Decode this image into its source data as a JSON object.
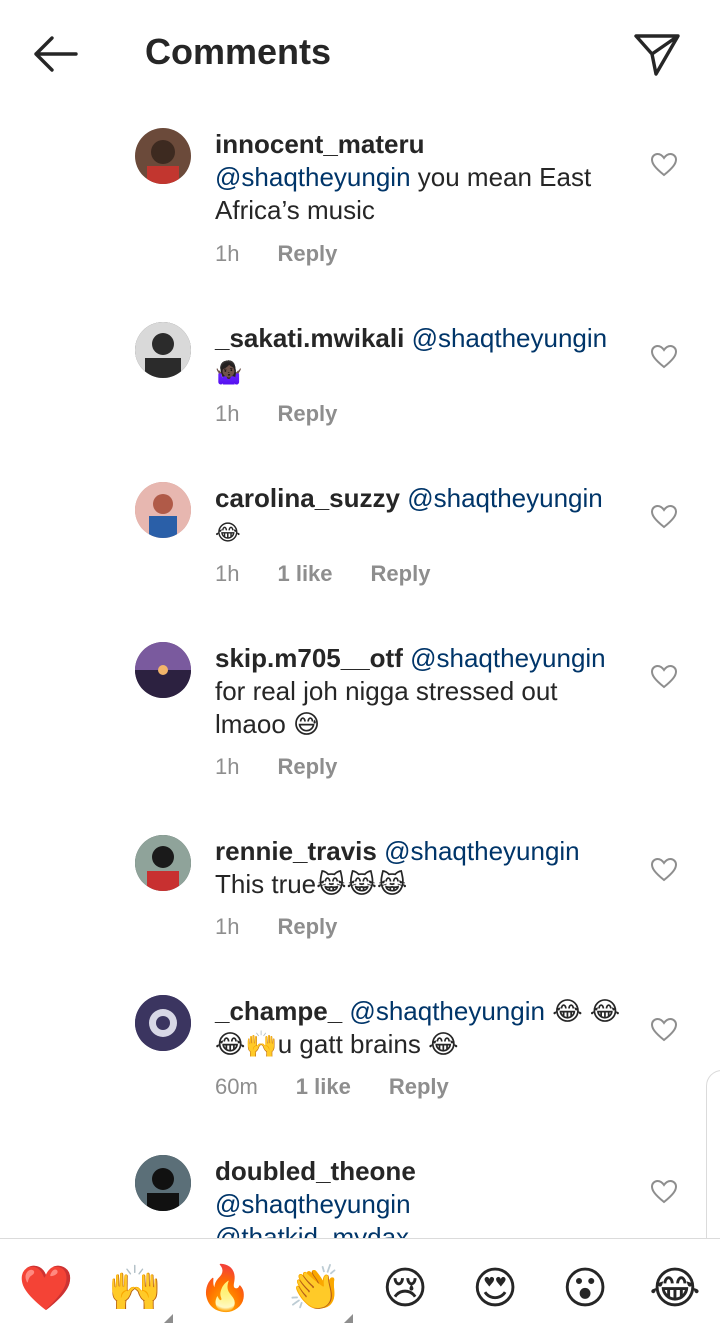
{
  "header": {
    "title": "Comments",
    "back_icon": "arrow-left-icon",
    "send_icon": "paper-plane-icon"
  },
  "comments": [
    {
      "username": "innocent_materu",
      "mention": "@shaqtheyungin",
      "text": " you mean East Africa’s music",
      "time": "1h",
      "likes": "",
      "reply": "Reply",
      "avatar_color": "#6b4a3a"
    },
    {
      "username": "_sakati.mwikali",
      "mention": "@shaqtheyungin",
      "text": "🤷🏿‍♀️",
      "time": "1h",
      "likes": "",
      "reply": "Reply",
      "avatar_color": "#3a3a3a"
    },
    {
      "username": "carolina_suzzy",
      "mention": "@shaqtheyungin",
      "text": "😂",
      "time": "1h",
      "likes": "1 like",
      "reply": "Reply",
      "avatar_color": "#c9857a"
    },
    {
      "username": "skip.m705__otf",
      "mention": "@shaqtheyungin",
      "text": "for real joh nigga stressed out lmaoo 😅",
      "time": "1h",
      "likes": "",
      "reply": "Reply",
      "avatar_color": "#5a3f66"
    },
    {
      "username": "rennie_travis",
      "mention": "@shaqtheyungin",
      "text": "This true😹😹😹",
      "time": "1h",
      "likes": "",
      "reply": "Reply",
      "avatar_color": "#2f3b35"
    },
    {
      "username": "_champe_",
      "mention": "@shaqtheyungin",
      "text": " 😂 😂😂🙌u gatt brains 😂",
      "time": "60m",
      "likes": "1 like",
      "reply": "Reply",
      "avatar_color": "#3b3560"
    },
    {
      "username": "doubled_theone",
      "mention": "@shaqtheyungin",
      "text": "@thatkid_mydax",
      "time": "",
      "likes": "",
      "reply": "",
      "avatar_color": "#1f2b30"
    }
  ],
  "reactions": [
    {
      "emoji": "❤️",
      "icon": "red-heart-icon"
    },
    {
      "emoji": "🙌",
      "icon": "raising-hands-icon"
    },
    {
      "emoji": "🔥",
      "icon": "fire-icon"
    },
    {
      "emoji": "👏",
      "icon": "clapping-hands-icon"
    },
    {
      "emoji": "😢",
      "icon": "crying-face-icon"
    },
    {
      "emoji": "😍",
      "icon": "heart-eyes-icon"
    },
    {
      "emoji": "😮",
      "icon": "surprised-face-icon"
    },
    {
      "emoji": "😂",
      "icon": "tears-of-joy-icon"
    }
  ]
}
